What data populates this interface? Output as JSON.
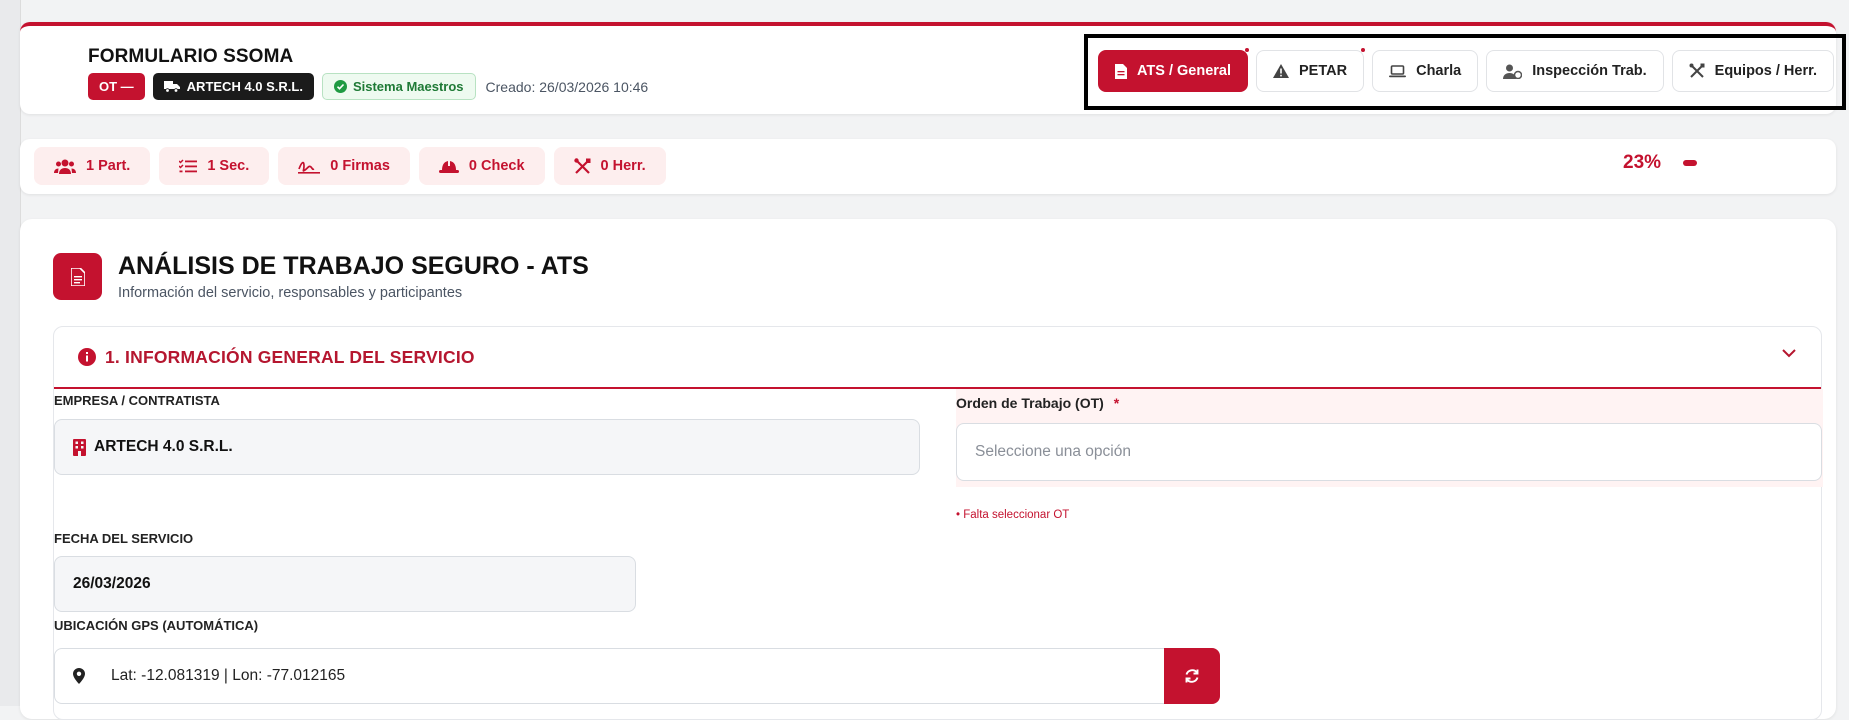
{
  "header": {
    "title": "FORMULARIO SSOMA",
    "badges": {
      "ot": "OT —",
      "company": "ARTECH 4.0 S.R.L.",
      "system": "Sistema Maestros"
    },
    "created": "Creado: 26/03/2026 10:46",
    "tabs": [
      {
        "label": "ATS / General",
        "icon": "document-icon",
        "active": true
      },
      {
        "label": "PETAR",
        "icon": "warning-icon",
        "active": false
      },
      {
        "label": "Charla",
        "icon": "laptop-icon",
        "active": false
      },
      {
        "label": "Inspección Trab.",
        "icon": "user-check-icon",
        "active": false
      },
      {
        "label": "Equipos / Herr.",
        "icon": "tools-icon",
        "active": false
      }
    ]
  },
  "stats": {
    "items": [
      {
        "label": "1 Part.",
        "icon": "users-icon"
      },
      {
        "label": "1 Sec.",
        "icon": "list-check-icon"
      },
      {
        "label": "0 Firmas",
        "icon": "signature-icon"
      },
      {
        "label": "0 Check",
        "icon": "helmet-icon"
      },
      {
        "label": "0 Herr.",
        "icon": "tools-icon"
      }
    ],
    "progress_label": "23%",
    "progress_value": 23
  },
  "main": {
    "title": "ANÁLISIS DE TRABAJO SEGURO - ATS",
    "subtitle": "Información del servicio, responsables y participantes",
    "section": {
      "title": "1. INFORMACIÓN GENERAL DEL SERVICIO",
      "fields": {
        "company_label": "EMPRESA / CONTRATISTA",
        "company_value": "ARTECH 4.0 S.R.L.",
        "ot_label": "Orden de Trabajo (OT)",
        "ot_required": "*",
        "ot_placeholder": "Seleccione una opción",
        "ot_error": "• Falta seleccionar OT",
        "date_label": "FECHA DEL SERVICIO",
        "date_value": "26/03/2026",
        "gps_label": "UBICACIÓN GPS (AUTOMÁTICA)",
        "gps_value": "Lat: -12.081319 | Lon: -77.012165"
      }
    }
  },
  "colors": {
    "accent": "#c4122f",
    "dark_badge": "#1b1b1b",
    "success": "#1f7a36"
  }
}
